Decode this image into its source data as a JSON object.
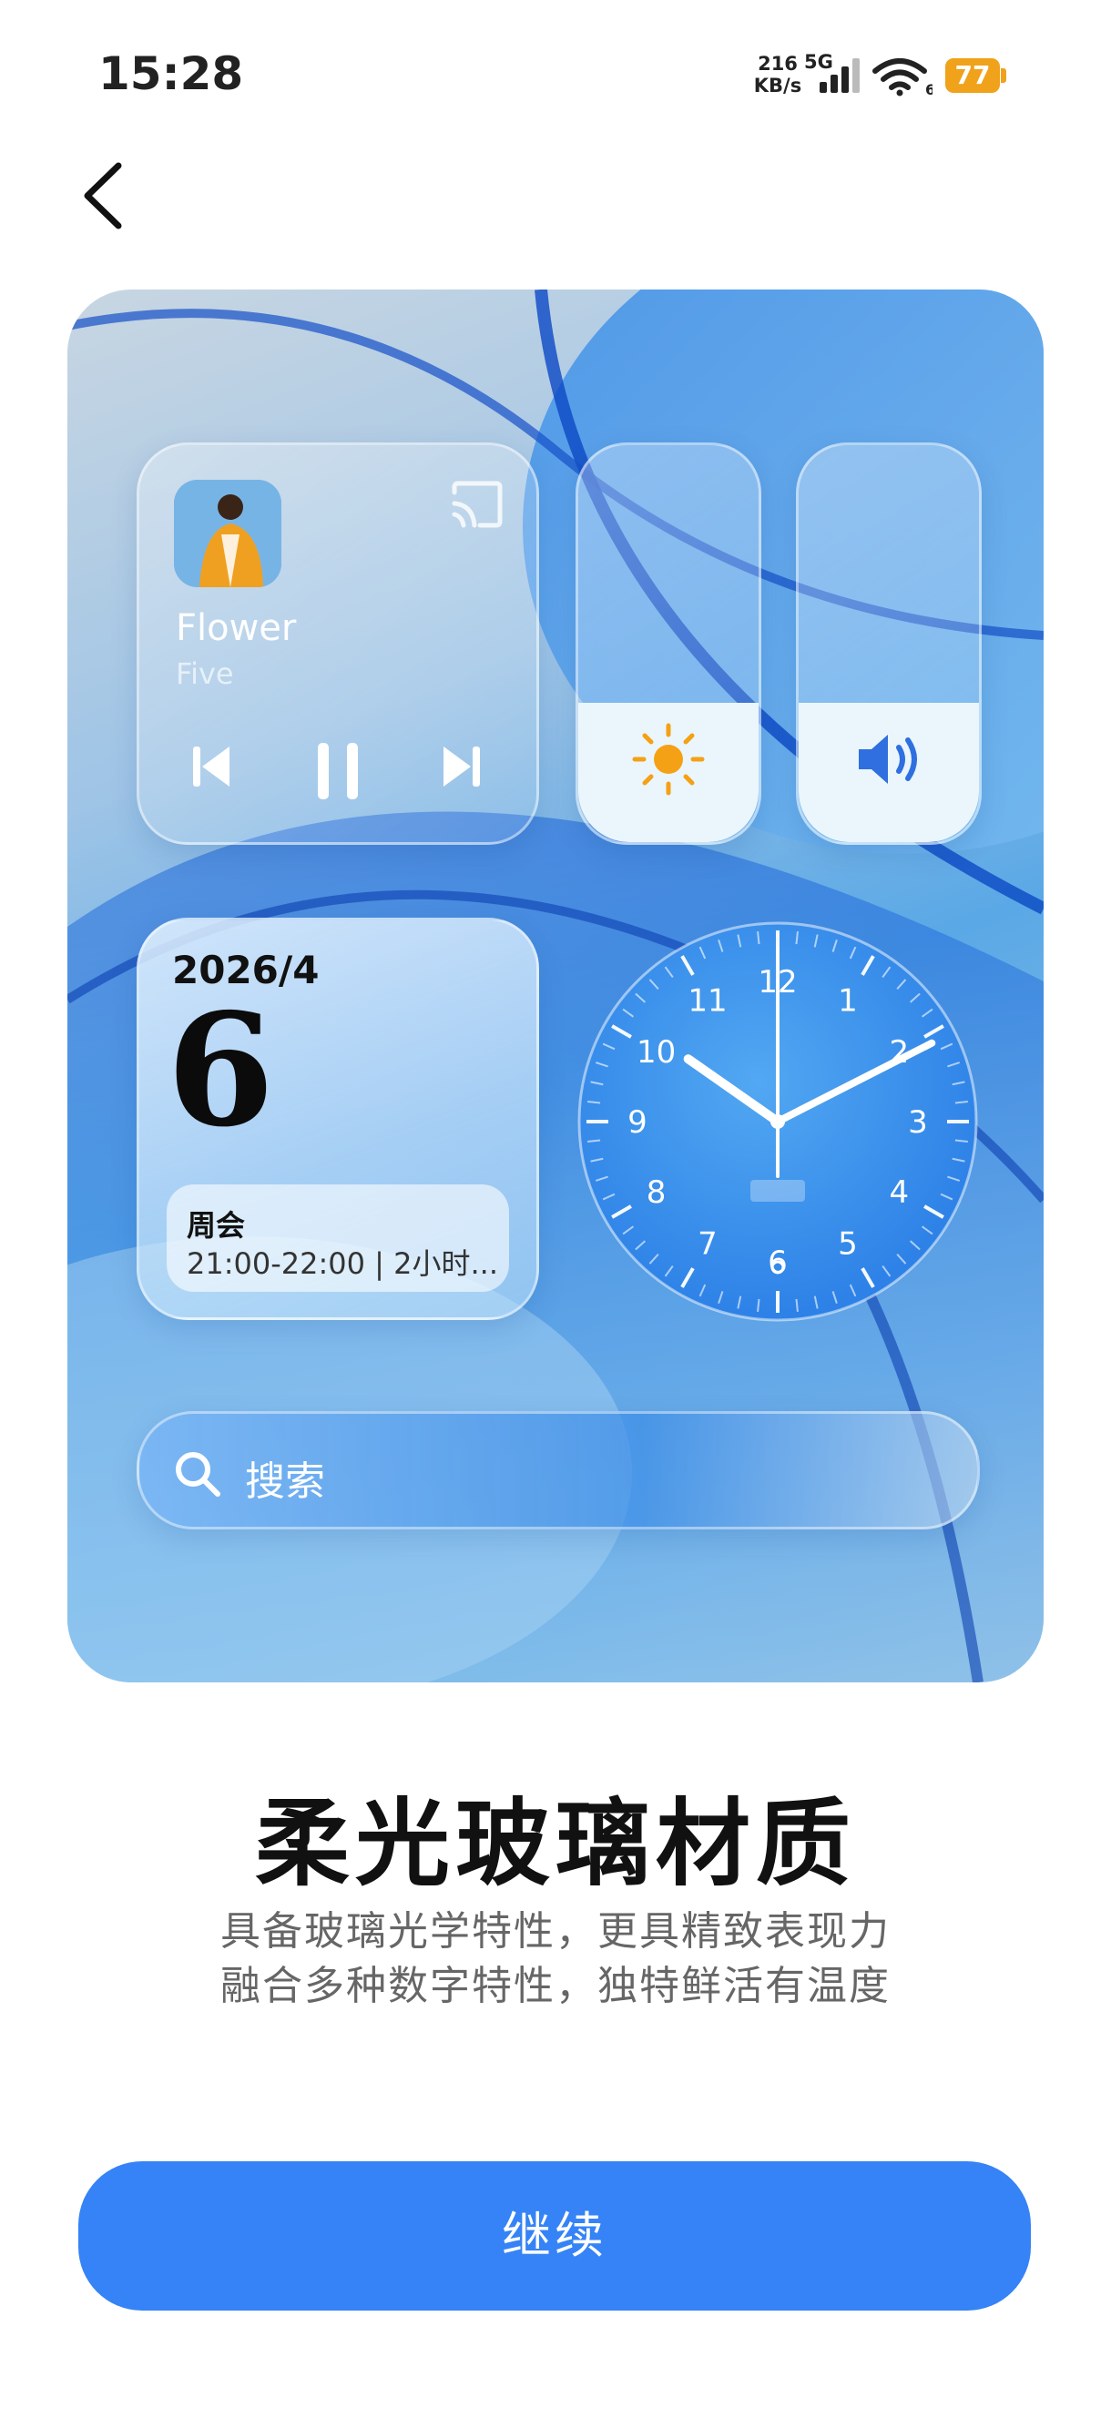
{
  "status_bar": {
    "time": "15:28",
    "net_speed_value": "216",
    "net_speed_unit": "KB/s",
    "network_type": "5G",
    "wifi_level": "6",
    "battery": "77",
    "battery_color": "#f0a21b"
  },
  "preview": {
    "music": {
      "title": "Flower",
      "artist": "Five"
    },
    "calendar": {
      "month": "2026/4",
      "day": "6",
      "event_title": "周会",
      "event_time": "21:00-22:00 | 2小时..."
    },
    "clock": {
      "numbers": [
        "12",
        "1",
        "2",
        "3",
        "4",
        "5",
        "6",
        "7",
        "8",
        "9",
        "10",
        "11"
      ],
      "hour": 10,
      "minute": 10,
      "second": 30
    },
    "search": {
      "placeholder": "搜索"
    },
    "brightness_level": 0.35,
    "volume_level": 0.35
  },
  "headline": "柔光玻璃材质",
  "description_line1": "具备玻璃光学特性，更具精致表现力",
  "description_line2": "融合多种数字特性，独特鲜活有温度",
  "continue_label": "继续",
  "accent_color": "#3583f6"
}
